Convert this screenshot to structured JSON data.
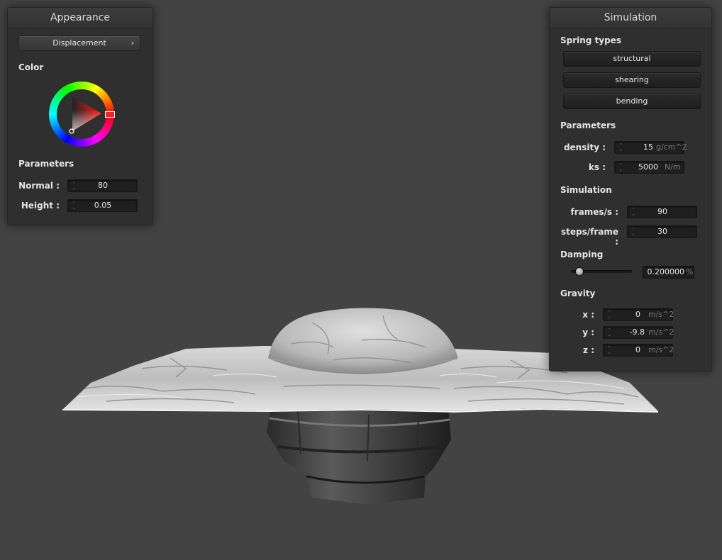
{
  "appearance": {
    "title": "Appearance",
    "shader_select": "Displacement",
    "shader_arrow_icon": "chevron-right-icon",
    "color_label": "Color",
    "color_wheel_icon": "color-wheel-icon",
    "selected_color": "#e8262a",
    "parameters_label": "Parameters",
    "normal": {
      "label": "Normal :",
      "value": "80"
    },
    "height": {
      "label": "Height :",
      "value": "0.05"
    }
  },
  "simulation": {
    "title": "Simulation",
    "spring_types_label": "Spring types",
    "springs": [
      "structural",
      "shearing",
      "bending"
    ],
    "parameters_label": "Parameters",
    "density": {
      "label": "density :",
      "value": "15",
      "unit": "g/cm^2"
    },
    "ks": {
      "label": "ks :",
      "value": "5000",
      "unit": "N/m"
    },
    "simulation_label": "Simulation",
    "frames": {
      "label": "frames/s :",
      "value": "90"
    },
    "steps": {
      "label": "steps/frame :",
      "value": "30"
    },
    "damping_label": "Damping",
    "damping": {
      "value": "0.200000",
      "unit": "%",
      "slider_fraction": 0.2
    },
    "gravity_label": "Gravity",
    "gravity": [
      {
        "label": "x :",
        "value": "0",
        "unit": "m/s^2"
      },
      {
        "label": "y :",
        "value": "-9.8",
        "unit": "m/s^2"
      },
      {
        "label": "z :",
        "value": "0",
        "unit": "m/s^2"
      }
    ]
  },
  "colors": {
    "background": "#434343",
    "panel": "#2f2f2f",
    "cloth": "#c4c4c4"
  }
}
